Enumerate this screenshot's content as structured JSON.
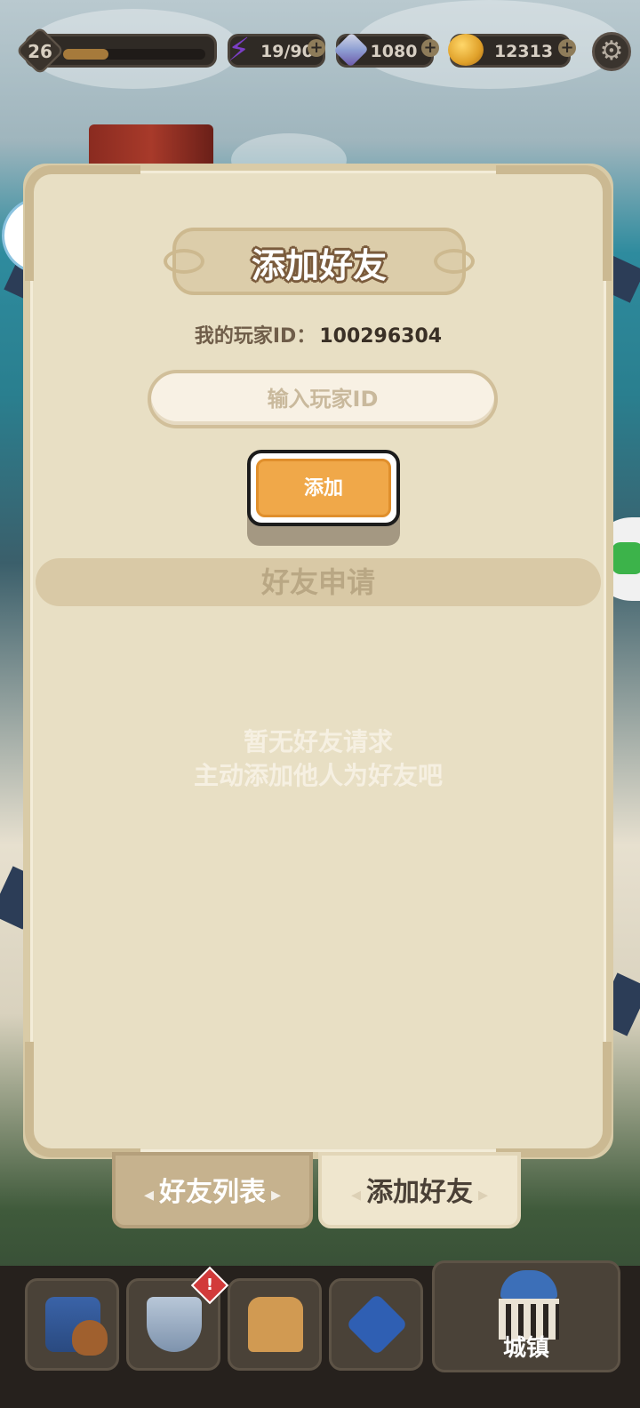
{
  "hud": {
    "level": "26",
    "xp_progress": 0.32,
    "energy": "19/90",
    "gems": "1080",
    "coins": "12313",
    "plus_symbol": "+"
  },
  "panel": {
    "title": "添加好友",
    "my_id_label": "我的玩家ID：",
    "my_id_value": "100296304",
    "input_placeholder": "输入玩家ID",
    "add_button": "添加",
    "section_header": "好友申请",
    "empty_line1": "暂无好友请求",
    "empty_line2": "主动添加他人为好友吧"
  },
  "tabs": {
    "friend_list": "好友列表",
    "add_friend": "添加好友",
    "active": "add_friend"
  },
  "nav": {
    "town_label": "城镇",
    "alert_badge": "!"
  },
  "colors": {
    "panel_bg": "#e8dfc4",
    "button_orange": "#f0a849",
    "title_outline": "#7a5b3c"
  }
}
